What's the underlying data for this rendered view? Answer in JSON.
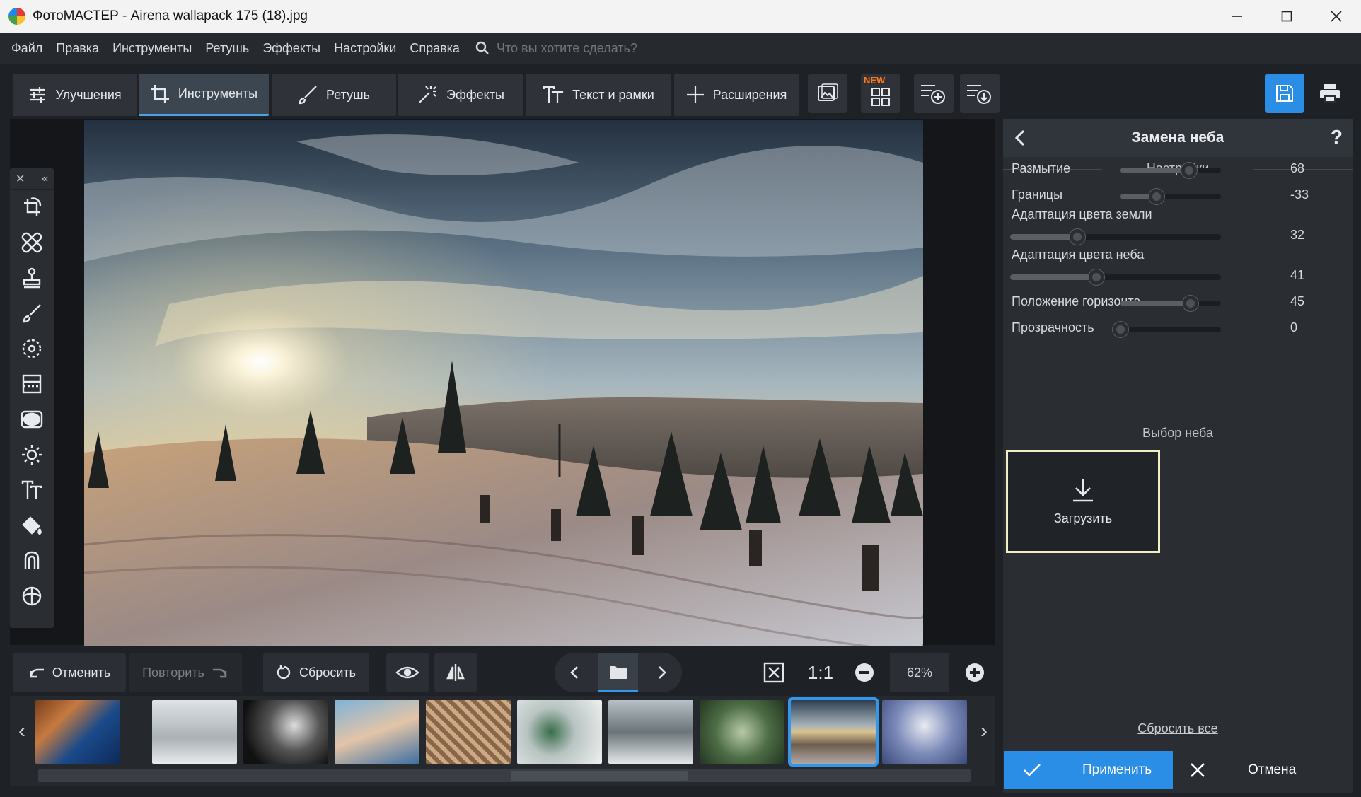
{
  "window": {
    "title": "ФотоМАСТЕР - Airena wallapack 175 (18).jpg",
    "minimize_icon": "minimize-icon",
    "maximize_icon": "maximize-icon",
    "close_icon": "close-icon"
  },
  "menu": {
    "items": [
      "Файл",
      "Правка",
      "Инструменты",
      "Ретушь",
      "Эффекты",
      "Настройки",
      "Справка"
    ],
    "search_placeholder": "Что вы хотите сделать?"
  },
  "tabs": [
    {
      "label": "Улучшения",
      "icon": "sliders-icon"
    },
    {
      "label": "Инструменты",
      "icon": "crop-icon",
      "active": true
    },
    {
      "label": "Ретушь",
      "icon": "brush-icon"
    },
    {
      "label": "Эффекты",
      "icon": "magic-wand-icon"
    },
    {
      "label": "Текст и рамки",
      "icon": "text-icon"
    },
    {
      "label": "Расширения",
      "icon": "plus-icon"
    }
  ],
  "toolbar_badge": "NEW",
  "canvas": {
    "zoom": "62%",
    "one_to_one": "1:1"
  },
  "bottom": {
    "undo": "Отменить",
    "redo": "Повторить",
    "reset": "Сбросить"
  },
  "panel": {
    "title": "Замена неба",
    "help": "?",
    "settings_title": "Настройки",
    "sliders": [
      {
        "label": "Размытие",
        "value": "68",
        "fraction": 0.68
      },
      {
        "label": "Границы",
        "value": "-33",
        "fraction": 0.36
      },
      {
        "label": "Адаптация цвета земли",
        "value": "32",
        "fraction": 0.32
      },
      {
        "label": "Адаптация цвета неба",
        "value": "41",
        "fraction": 0.41
      },
      {
        "label": "Положение горизонта",
        "value": "45",
        "fraction": 0.7
      },
      {
        "label": "Прозрачность",
        "value": "0",
        "fraction": 0.0
      }
    ],
    "sky_choice_title": "Выбор неба",
    "upload_label": "Загрузить",
    "reset_all": "Сбросить все",
    "apply": "Применить",
    "cancel": "Отмена"
  },
  "colors": {
    "accent": "#2a8de6",
    "panel_bg": "#2a2e33",
    "app_bg": "#1e2126",
    "new_badge": "#ff7a1a"
  }
}
